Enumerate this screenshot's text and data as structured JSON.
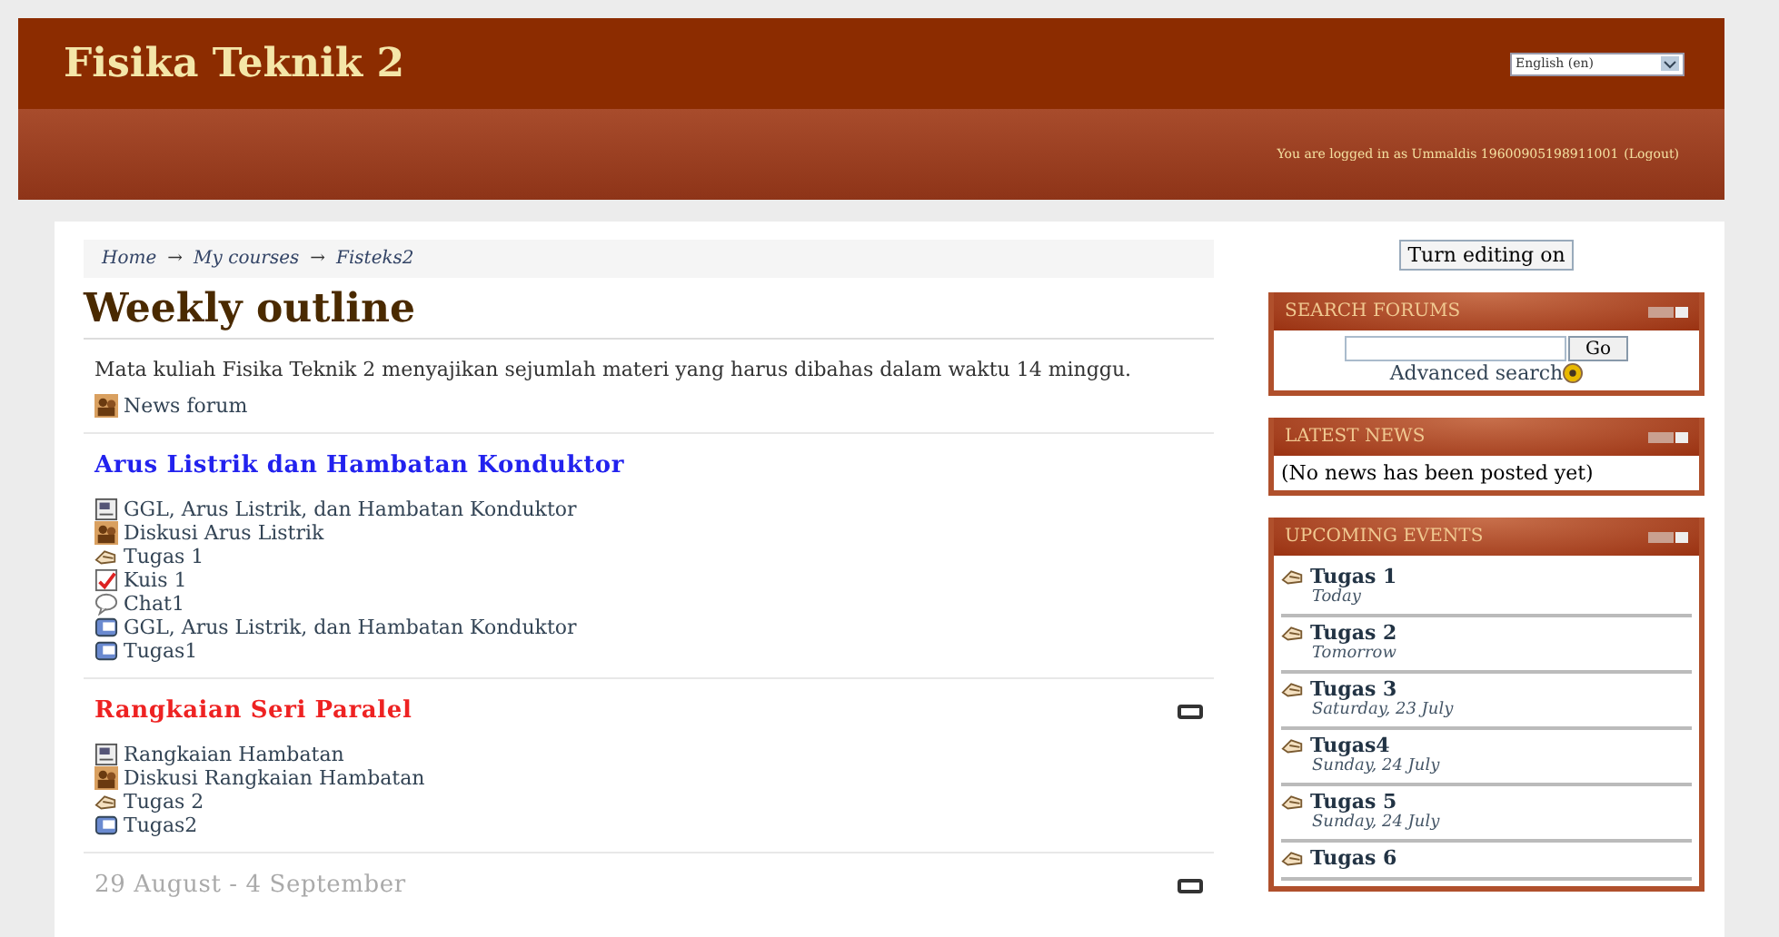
{
  "header": {
    "title": "Fisika Teknik 2",
    "language": "English (en)",
    "login_text": "You are logged in as Ummaldis 19600905198911001",
    "logout": "(Logout)"
  },
  "breadcrumb": {
    "separator": "→",
    "items": [
      "Home",
      "My courses",
      "Fisteks2"
    ]
  },
  "editing_button": "Turn editing on",
  "page_title": "Weekly outline",
  "summary": "Mata kuliah Fisika Teknik 2 menyajikan sejumlah materi yang harus dibahas dalam waktu 14 minggu.",
  "general_items": [
    {
      "kind": "forum",
      "label": "News forum"
    }
  ],
  "sections": [
    {
      "title": "Arus Listrik dan Hambatan Konduktor",
      "color": "#2222ee",
      "kind": "topic",
      "collapse_icon": false,
      "items": [
        {
          "kind": "resource",
          "label": "GGL, Arus Listrik, dan Hambatan Konduktor"
        },
        {
          "kind": "forum",
          "label": "Diskusi Arus Listrik"
        },
        {
          "kind": "assignment",
          "label": "Tugas 1"
        },
        {
          "kind": "quiz",
          "label": "Kuis 1"
        },
        {
          "kind": "chat",
          "label": "Chat1"
        },
        {
          "kind": "wiki",
          "label": "GGL, Arus Listrik, dan Hambatan Konduktor"
        },
        {
          "kind": "wiki",
          "label": "Tugas1"
        }
      ]
    },
    {
      "title": "Rangkaian Seri Paralel",
      "color": "#ee2222",
      "kind": "topic",
      "collapse_icon": true,
      "items": [
        {
          "kind": "resource",
          "label": "Rangkaian Hambatan"
        },
        {
          "kind": "forum",
          "label": "Diskusi Rangkaian Hambatan"
        },
        {
          "kind": "assignment",
          "label": "Tugas 2"
        },
        {
          "kind": "wiki",
          "label": "Tugas2"
        }
      ]
    },
    {
      "title": "29 August - 4 September",
      "color": "#aaaaaa",
      "kind": "week",
      "collapse_icon": true
    }
  ],
  "blocks": [
    {
      "kind": "search",
      "title": "SEARCH FORUMS",
      "button": "Go",
      "link": "Advanced search"
    },
    {
      "kind": "text",
      "title": "LATEST NEWS",
      "text": "(No news has been posted yet)"
    },
    {
      "kind": "events",
      "title": "UPCOMING EVENTS",
      "events": [
        {
          "name": "Tugas 1",
          "date": "Today"
        },
        {
          "name": "Tugas 2",
          "date": "Tomorrow"
        },
        {
          "name": "Tugas 3",
          "date": "Saturday, 23 July"
        },
        {
          "name": "Tugas4",
          "date": "Sunday, 24 July"
        },
        {
          "name": "Tugas 5",
          "date": "Sunday, 24 July"
        },
        {
          "name": "Tugas 6"
        }
      ]
    }
  ]
}
